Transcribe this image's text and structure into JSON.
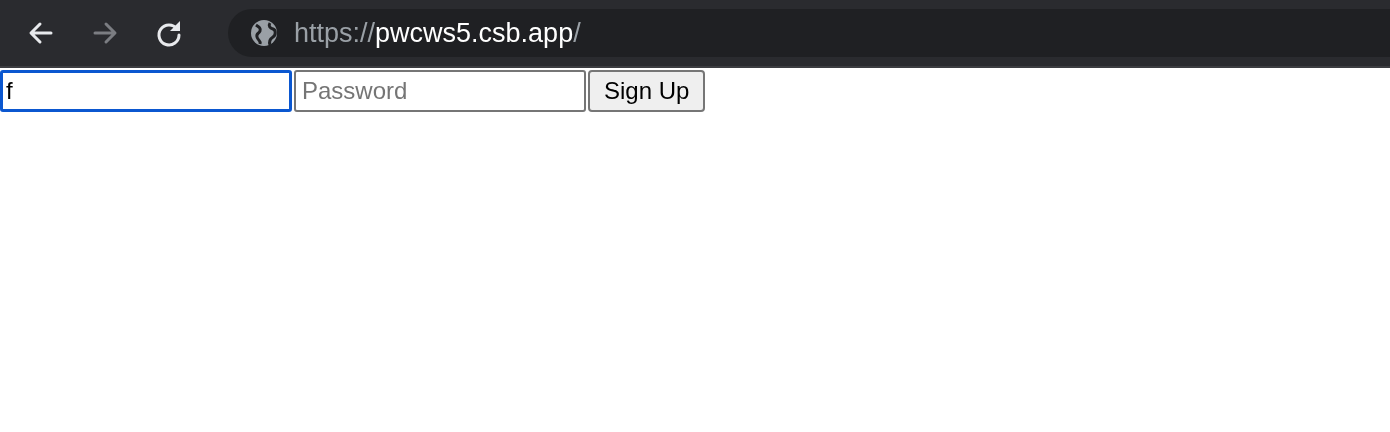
{
  "toolbar": {
    "back": {
      "disabled": false
    },
    "forward": {
      "disabled": true
    },
    "reload": {
      "disabled": false
    },
    "address": {
      "scheme": "https://",
      "host": "pwcws5.csb.app",
      "path": "/"
    }
  },
  "form": {
    "fields": [
      {
        "kind": "text",
        "value": "f",
        "focused": true
      },
      {
        "kind": "password",
        "placeholder": "Password",
        "focused": false
      }
    ],
    "button": "Sign Up"
  }
}
